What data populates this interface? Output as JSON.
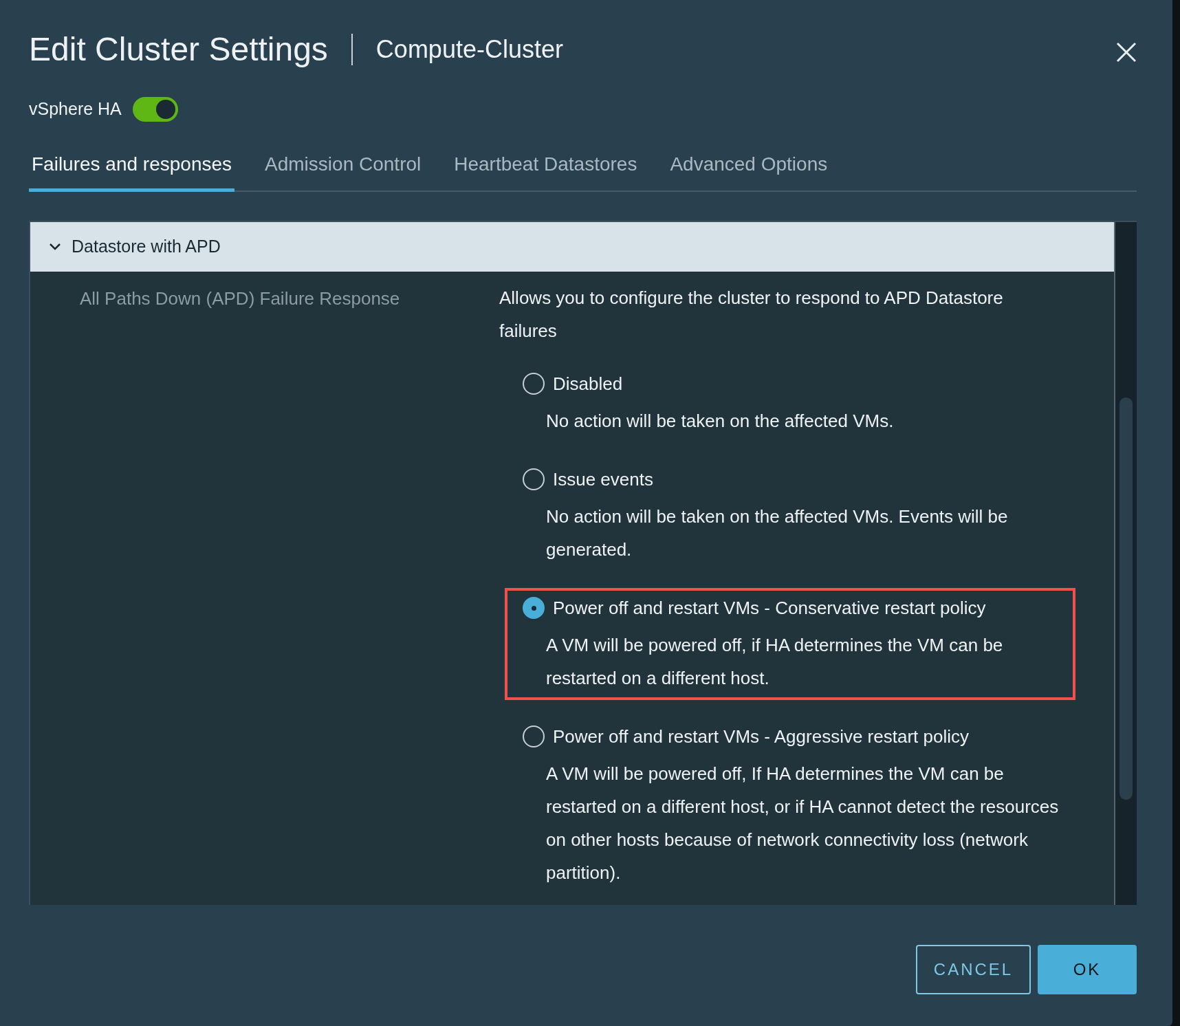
{
  "dialog": {
    "title": "Edit Cluster Settings",
    "subtitle": "Compute-Cluster"
  },
  "ha_toggle": {
    "label": "vSphere HA",
    "on": true
  },
  "tabs": [
    {
      "label": "Failures and responses",
      "selected": true
    },
    {
      "label": "Admission Control",
      "selected": false
    },
    {
      "label": "Heartbeat Datastores",
      "selected": false
    },
    {
      "label": "Advanced Options",
      "selected": false
    }
  ],
  "section": {
    "title": "Datastore with APD",
    "expanded": true,
    "setting_label": "All Paths Down (APD) Failure Response",
    "setting_description": "Allows you to configure the cluster to respond to APD Datastore failures",
    "options": [
      {
        "label": "Disabled",
        "description": "No action will be taken on the affected VMs.",
        "selected": false,
        "highlighted": false
      },
      {
        "label": "Issue events",
        "description": "No action will be taken on the affected VMs. Events will be generated.",
        "selected": false,
        "highlighted": false
      },
      {
        "label": "Power off and restart VMs - Conservative restart policy",
        "description": "A VM will be powered off, if HA determines the VM can be restarted on a different host.",
        "selected": true,
        "highlighted": true
      },
      {
        "label": "Power off and restart VMs - Aggressive restart policy",
        "description": "A VM will be powered off, If HA determines the VM can be restarted on a different host, or if HA cannot detect the resources on other hosts because of network connectivity loss (network partition).",
        "selected": false,
        "highlighted": false
      }
    ]
  },
  "buttons": [
    {
      "label": "CANCEL",
      "kind": "outline"
    },
    {
      "label": "OK",
      "kind": "primary"
    }
  ]
}
